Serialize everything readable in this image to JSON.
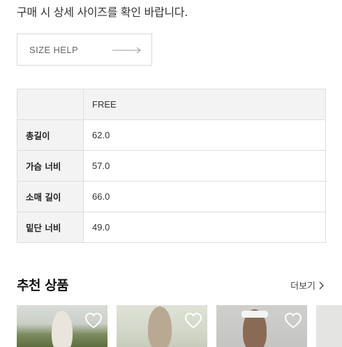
{
  "notice": "구매 시 상세 사이즈를 확인 바랍니다.",
  "size_help": {
    "label": "SIZE HELP",
    "icon": "long-arrow-right-icon"
  },
  "size_table": {
    "columns": [
      "FREE"
    ],
    "rows": [
      {
        "label": "총길이",
        "values": [
          "62.0"
        ]
      },
      {
        "label": "가슴 너비",
        "values": [
          "57.0"
        ]
      },
      {
        "label": "소매 길이",
        "values": [
          "66.0"
        ]
      },
      {
        "label": "밑단 너비",
        "values": [
          "49.0"
        ]
      }
    ]
  },
  "recommended": {
    "title": "추천 상품",
    "more_label": "더보기",
    "more_icon": "chevron-right-icon",
    "products": [
      {
        "heart_icon": "heart-outline-icon"
      },
      {
        "heart_icon": "heart-outline-icon"
      },
      {
        "heart_icon": "heart-outline-icon"
      },
      {
        "heart_icon": "heart-outline-icon"
      }
    ]
  }
}
